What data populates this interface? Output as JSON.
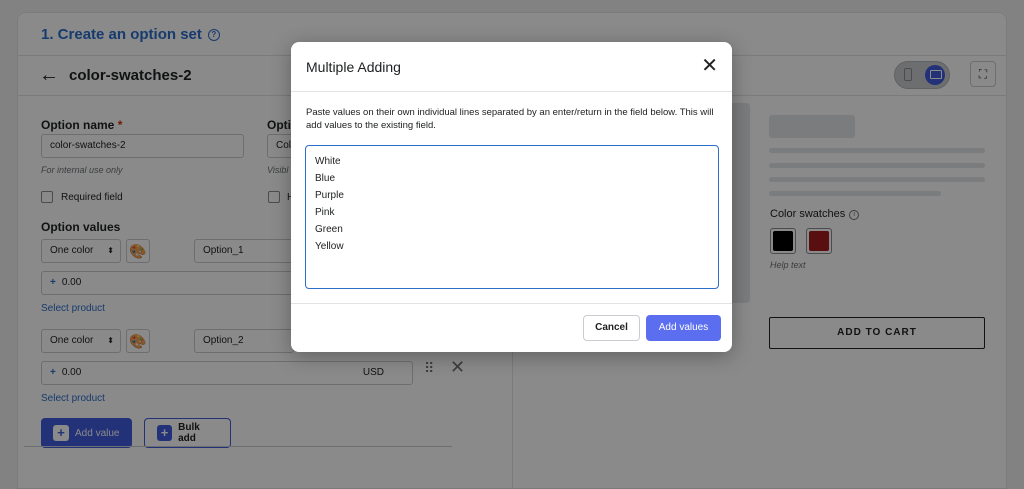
{
  "header": {
    "section_title": "1. Create an option set",
    "help_glyph": "?",
    "back_arrow": "←",
    "set_name": "color-swatches-2",
    "expand_glyph": "⛶"
  },
  "form": {
    "option_name_label": "Option name",
    "required_mark": "*",
    "option_name_value": "color-swatches-2",
    "option_name_hint": "For internal use only",
    "second_label": "Opti",
    "second_value": "Col",
    "second_hint": "Visibl",
    "required_field_label": "Required field",
    "second_checkbox_label": "H",
    "option_values_label": "Option values",
    "rows": [
      {
        "type": "One color",
        "name": "Option_1",
        "price": "0.00",
        "select_product": "Select product"
      },
      {
        "type": "One color",
        "name": "Option_2",
        "price": "0.00",
        "currency": "USD",
        "select_product": "Select product"
      }
    ],
    "plus_glyph": "+",
    "caret_glyph": "⬍",
    "palette_glyph": "🎨",
    "drag_glyph": "⠿",
    "remove_glyph": "✕",
    "add_value_label": "Add value",
    "bulk_add_label": "Bulk add"
  },
  "preview": {
    "swatch_title": "Color swatches",
    "info_glyph": "i",
    "swatches": [
      {
        "color": "#000000"
      },
      {
        "color": "#a51d1d"
      }
    ],
    "help_text": "Help text",
    "add_to_cart": "ADD TO CART"
  },
  "modal": {
    "title": "Multiple Adding",
    "close_glyph": "✕",
    "description": "Paste values on their own individual lines separated by an enter/return in the field below. This will add values to the existing field.",
    "values": [
      "White",
      "Blue",
      "Purple",
      "Pink",
      "Green",
      "Yellow"
    ],
    "cancel_label": "Cancel",
    "add_values_label": "Add values"
  },
  "colors": {
    "accent": "#3f5bde",
    "link": "#2c6ecb",
    "primary_button": "#5b6ef0"
  }
}
